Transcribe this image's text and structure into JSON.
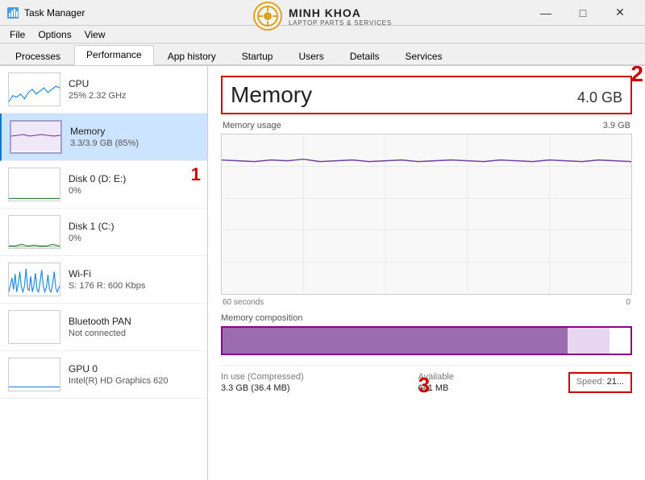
{
  "titleBar": {
    "title": "Task Manager",
    "controls": {
      "minimize": "—",
      "maximize": "□",
      "close": "✕"
    }
  },
  "logo": {
    "name": "MINH KHOA",
    "subtitle": "LAPTOP PARTS & SERVICES"
  },
  "menuBar": {
    "items": [
      "File",
      "Options",
      "View"
    ]
  },
  "tabs": {
    "items": [
      "Processes",
      "Performance",
      "App history",
      "Startup",
      "Users",
      "Details",
      "Services"
    ],
    "active": "Performance"
  },
  "sidebar": {
    "items": [
      {
        "name": "CPU",
        "detail": "25%  2.32 GHz",
        "type": "cpu"
      },
      {
        "name": "Memory",
        "detail": "3.3/3.9 GB (85%)",
        "type": "memory",
        "active": true
      },
      {
        "name": "Disk 0 (D: E:)",
        "detail": "0%",
        "type": "disk0",
        "annotation": "1"
      },
      {
        "name": "Disk 1 (C:)",
        "detail": "0%",
        "type": "disk1"
      },
      {
        "name": "Wi-Fi",
        "detail": "S: 176  R: 600 Kbps",
        "type": "wifi"
      },
      {
        "name": "Bluetooth PAN",
        "detail": "Not connected",
        "type": "bluetooth"
      },
      {
        "name": "GPU 0",
        "detail": "Intel(R) HD Graphics 620",
        "type": "gpu"
      }
    ]
  },
  "mainPanel": {
    "title": "Memory",
    "totalSize": "4.0 GB",
    "usageLabel": "Memory usage",
    "usageValue": "3.9 GB",
    "graphTime": {
      "left": "60 seconds",
      "right": "0"
    },
    "compositionLabel": "Memory composition",
    "bottomStats": {
      "inUseLabel": "In use (Compressed)",
      "inUseValue": "3.3 GB (36.4 MB)",
      "availableLabel": "Available",
      "availableValue": "641 MB",
      "speedLabel": "Speed:",
      "speedValue": "21..."
    }
  },
  "annotations": {
    "a1": "1",
    "a2": "2",
    "a3": "3"
  },
  "colors": {
    "accent": "#0078d7",
    "graphLine": "#7040a0",
    "graphBg": "#f5f5f5",
    "activeTab": "#ffffff",
    "redBorder": "#cc0000",
    "sidebarActive": "#cce4ff"
  }
}
